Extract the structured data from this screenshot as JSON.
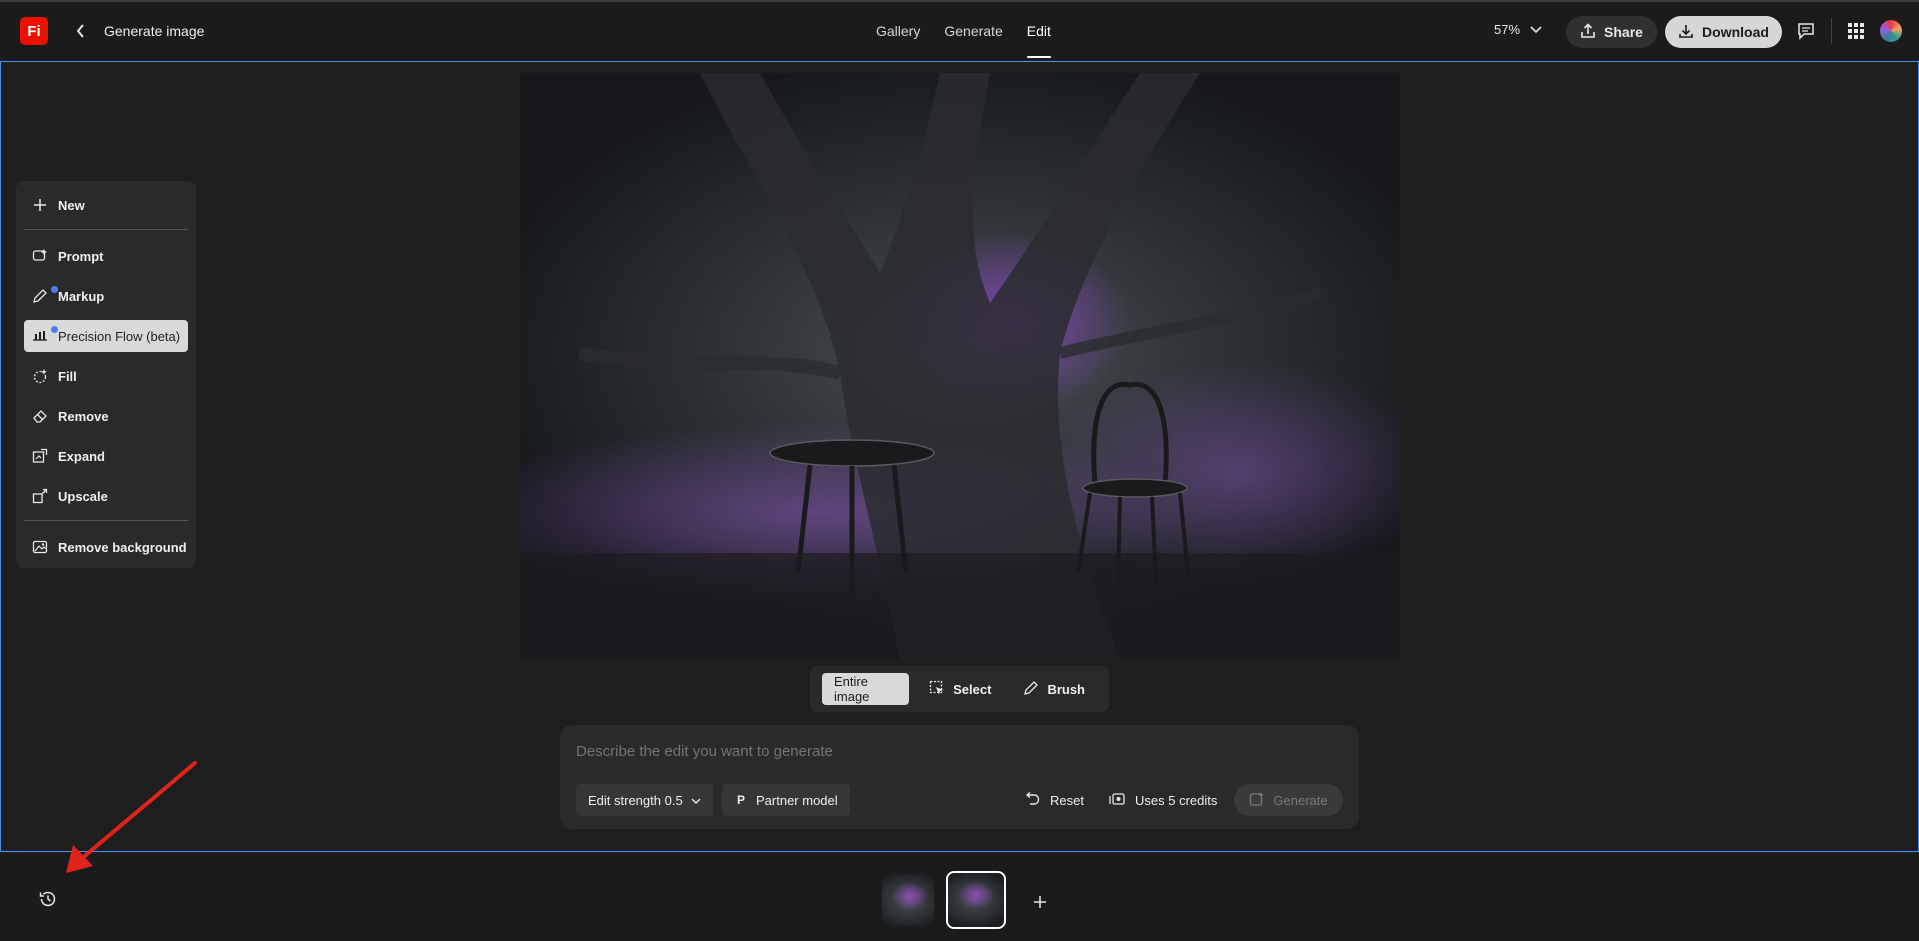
{
  "header": {
    "logo_text": "Fi",
    "back_icon": "chevron-left-icon",
    "title": "Generate image",
    "tabs": [
      {
        "label": "Gallery",
        "active": false
      },
      {
        "label": "Generate",
        "active": false
      },
      {
        "label": "Edit",
        "active": true
      }
    ],
    "zoom": "57%",
    "share_label": "Share",
    "download_label": "Download"
  },
  "left_panel": {
    "new_label": "New",
    "items": [
      {
        "label": "Prompt",
        "icon": "prompt-icon",
        "dot": false,
        "selected": false
      },
      {
        "label": "Markup",
        "icon": "markup-icon",
        "dot": true,
        "selected": false
      },
      {
        "label": "Precision Flow (beta)",
        "icon": "sliders-icon",
        "dot": true,
        "selected": true
      },
      {
        "label": "Fill",
        "icon": "fill-icon",
        "dot": false,
        "selected": false
      },
      {
        "label": "Remove",
        "icon": "eraser-icon",
        "dot": false,
        "selected": false
      },
      {
        "label": "Expand",
        "icon": "expand-icon",
        "dot": false,
        "selected": false
      },
      {
        "label": "Upscale",
        "icon": "upscale-icon",
        "dot": false,
        "selected": false
      }
    ],
    "remove_background_label": "Remove background"
  },
  "selection_bar": {
    "entire_image": "Entire image",
    "select": "Select",
    "brush": "Brush"
  },
  "prompt_box": {
    "placeholder": "Describe the edit you want to generate",
    "edit_strength": "Edit strength 0.5",
    "partner_model_badge": "P",
    "partner_model": "Partner model",
    "reset": "Reset",
    "credits": "Uses 5 credits",
    "generate": "Generate"
  },
  "colors": {
    "accent_blue": "#4d8ee8",
    "brand_red": "#eb1000",
    "dot_blue": "#4f7df0",
    "annotation_red": "#e0241b"
  }
}
